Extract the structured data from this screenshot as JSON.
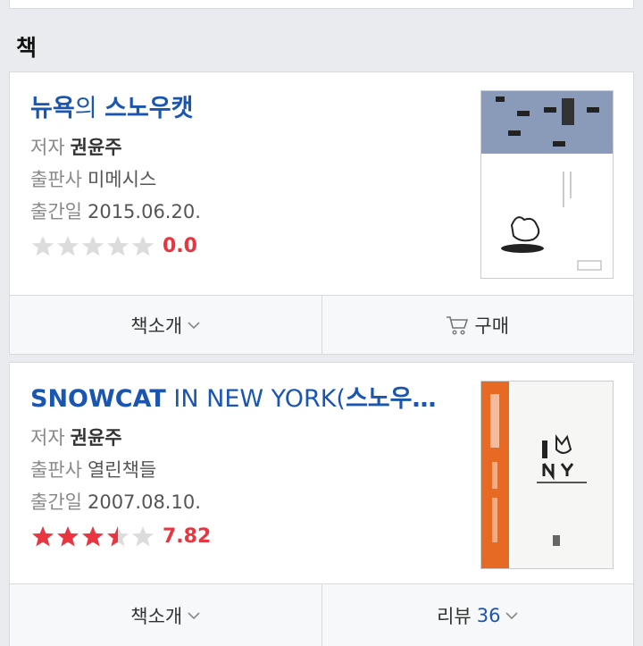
{
  "section": {
    "title": "책"
  },
  "books": [
    {
      "title_bold_1": "뉴욕",
      "title_normal": "의 ",
      "title_bold_2": "스노우캣",
      "author_label": "저자",
      "author": "권윤주",
      "publisher_label": "출판사",
      "publisher": "미메시스",
      "date_label": "출간일",
      "date": "2015.06.20.",
      "rating": 0.0,
      "rating_text": "0.0",
      "actions": {
        "intro": "책소개",
        "buy": "구매"
      }
    },
    {
      "title_bold_1": "SNOWCAT",
      "title_normal": " IN NEW YORK(",
      "title_bold_2": "스노우…",
      "author_label": "저자",
      "author": "권윤주",
      "publisher_label": "출판사",
      "publisher": "열린책들",
      "date_label": "출간일",
      "date": "2007.08.10.",
      "rating": 3.5,
      "rating_text": "7.82",
      "actions": {
        "intro": "책소개",
        "review": "리뷰",
        "review_count": "36"
      }
    }
  ],
  "colors": {
    "link": "#1a56b0",
    "star_on": "#e8353f",
    "star_off": "#dcdcdc"
  }
}
